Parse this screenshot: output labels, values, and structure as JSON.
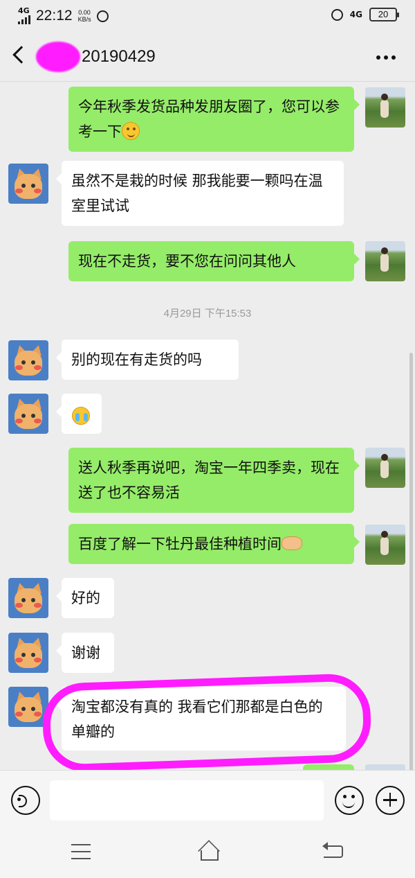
{
  "status_bar": {
    "network": "4G",
    "time": "22:12",
    "speed_value": "0.00",
    "speed_unit": "KB/s",
    "right_network": "4G",
    "battery": "20"
  },
  "header": {
    "title": "20190429"
  },
  "messages": [
    {
      "side": "out",
      "text": "今年秋季发货品种发朋友圈了，您可以参考一下",
      "emoji": "smile"
    },
    {
      "side": "in",
      "text": "虽然不是栽的时候 那我能要一颗吗在温室里试试"
    },
    {
      "side": "out",
      "text": "现在不走货，要不您在问问其他人"
    },
    {
      "side": "time",
      "text": "4月29日 下午15:53"
    },
    {
      "side": "in",
      "text": "别的现在有走货的吗"
    },
    {
      "side": "in",
      "text": "",
      "emoji": "cry"
    },
    {
      "side": "out",
      "text": "送人秋季再说吧，淘宝一年四季卖，现在送了也不容易活"
    },
    {
      "side": "out",
      "text": "百度了解一下牡丹最佳种植时间",
      "emoji": "handshake"
    },
    {
      "side": "in",
      "text": "好的"
    },
    {
      "side": "in",
      "text": "谢谢"
    },
    {
      "side": "in",
      "text": "淘宝都没有真的 我看它们那都是白色的单瓣的"
    }
  ],
  "icons": {
    "back": "chevron-left-icon",
    "more": "ellipsis-icon",
    "voice": "voice-icon",
    "emoji": "smiley-icon",
    "plus": "plus-icon",
    "menu": "menu-icon",
    "home": "home-icon",
    "return": "return-icon"
  },
  "colors": {
    "outgoing_bubble": "#95ec69",
    "incoming_bubble": "#ffffff",
    "background": "#ededed",
    "highlight": "#ff1cff"
  }
}
